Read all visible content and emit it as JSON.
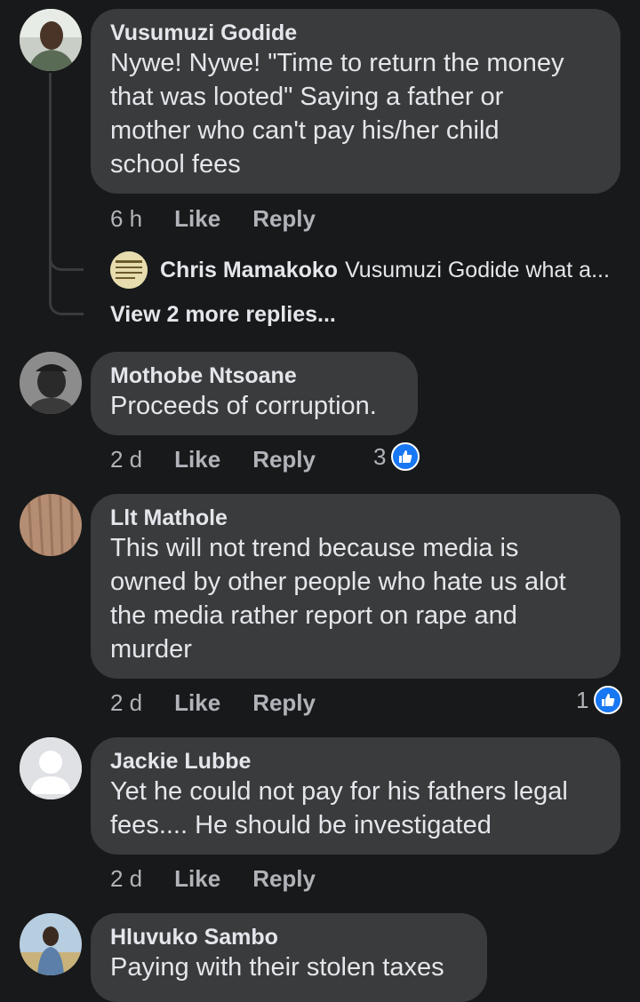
{
  "comments": [
    {
      "author": "Vusumuzi Godide",
      "text": "Nywe! Nywe! \"Time to return the money\nthat was looted\" Saying a father or\nmother who can't pay his/her child\nschool fees",
      "time": "6 h",
      "like": "Like",
      "reply": "Reply",
      "reply_preview": {
        "author": "Chris Mamakoko",
        "text": "Vusumuzi Godide what a..."
      },
      "more_replies": "View 2 more replies..."
    },
    {
      "author": "Mothobe Ntsoane",
      "text": "Proceeds of corruption.",
      "time": "2 d",
      "like": "Like",
      "reply": "Reply",
      "reactions": "3"
    },
    {
      "author": "Llt Mathole",
      "text": "This will not trend because media is\nowned by other people who hate us alot\nthe media rather report on rape and\nmurder",
      "time": "2 d",
      "like": "Like",
      "reply": "Reply",
      "reactions": "1"
    },
    {
      "author": "Jackie Lubbe",
      "text": "Yet he could not pay for his fathers legal\nfees.... He should be investigated",
      "time": "2 d",
      "like": "Like",
      "reply": "Reply"
    },
    {
      "author": "Hluvuko Sambo",
      "text": "Paying with their stolen taxes"
    }
  ],
  "colors": {
    "background": "#18191a",
    "bubble": "#3a3b3c",
    "like_accent": "#1877f2"
  }
}
